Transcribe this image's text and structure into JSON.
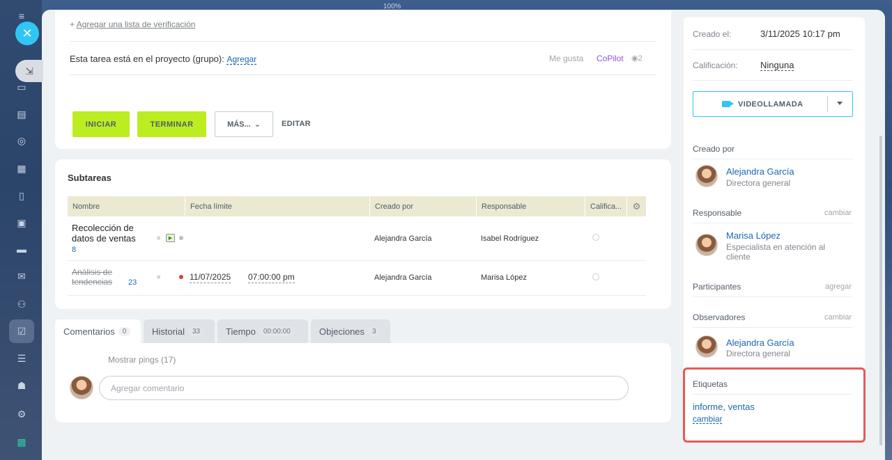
{
  "background": {
    "zoom": "100%"
  },
  "top_card": {
    "add_checklist": "Agregar una lista de verificación",
    "project_text": "Esta tarea está en el proyecto (grupo):",
    "project_link": "Agregar",
    "like": "Me gusta",
    "copilot": "CoPilot",
    "views": "2",
    "buttons": {
      "start": "INICIAR",
      "finish": "TERMINAR",
      "more": "MÁS...",
      "edit": "EDITAR"
    }
  },
  "subtasks": {
    "title": "Subtareas",
    "columns": [
      "Nombre",
      "Fecha límite",
      "Creado por",
      "Responsable",
      "Califica..."
    ],
    "rows": [
      {
        "name": "Recolección de datos de ventas",
        "count": "8",
        "deadline_date": "",
        "deadline_time": "",
        "created_by": "Alejandra García",
        "responsible": "Isabel Rodríguez"
      },
      {
        "name": "Análisis de tendencias",
        "count": "23",
        "deadline_date": "11/07/2025",
        "deadline_time": "07:00:00 pm",
        "created_by": "Alejandra García",
        "responsible": "Marisa López"
      }
    ]
  },
  "tabs": [
    {
      "label": "Comentarios",
      "count": "0"
    },
    {
      "label": "Historial",
      "count": "33"
    },
    {
      "label": "Tiempo",
      "count": "00:00:00"
    },
    {
      "label": "Objeciones",
      "count": "3"
    }
  ],
  "comments": {
    "pings": "Mostrar pings (17)",
    "placeholder": "Agregar comentario"
  },
  "sidebar": {
    "created_on_label": "Creado el:",
    "created_on_value": "3/11/2025 10:17 pm",
    "rating_label": "Calificación:",
    "rating_value": "Ninguna",
    "video_call": "VIDEOLLAMADA",
    "created_by_label": "Creado por",
    "creator": {
      "name": "Alejandra García",
      "role": "Directora general"
    },
    "responsible_label": "Responsable",
    "responsible_action": "cambiar",
    "responsible": {
      "name": "Marisa López",
      "role": "Especialista en atención al cliente"
    },
    "participants_label": "Participantes",
    "participants_action": "agregar",
    "observers_label": "Observadores",
    "observers_action": "cambiar",
    "observer": {
      "name": "Alejandra García",
      "role": "Directora general"
    },
    "tags_label": "Etiquetas",
    "tags_value": "informe, ventas",
    "tags_action": "cambiar"
  },
  "colors": {
    "accent_green": "#bbed21",
    "accent_blue": "#2fc6f6",
    "link": "#2067b0",
    "highlight": "#e55b56"
  }
}
